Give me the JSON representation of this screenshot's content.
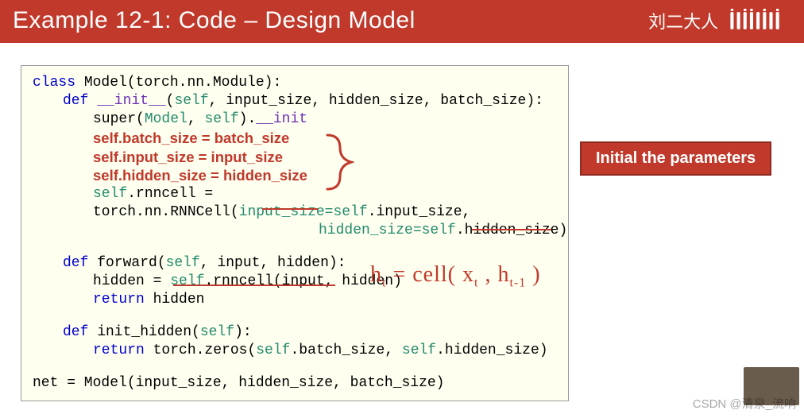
{
  "header": {
    "title": "Example 12-1: Code – Design Model",
    "author": "刘二大人",
    "platform_logo_alt": "bilibili"
  },
  "code": {
    "l1_class": "class",
    "l1_name": " Model(torch.nn.Module):",
    "l2_def": "def",
    "l2_fn": " __init__",
    "l2_sig_open": "(",
    "l2_self": "self",
    "l2_rest": ", input_size, hidden_size, batch_size):",
    "l3_super_open": "super(",
    "l3_super_cls": "Model",
    "l3_super_comma": ", ",
    "l3_super_self": "self",
    "l3_super_close": ").",
    "l3_super_init": "__init",
    "l4": "self.batch_size = batch_size",
    "l5": "self.input_size = input_size",
    "l6": "self.hidden_size = hidden_size",
    "l7_self": "self",
    "l7_mid": ".rnncell = torch.nn.",
    "l7_rnn": "RNNCell",
    "l7_open": "(",
    "l7_arg1k": "input_size=",
    "l7_arg1_self": "self",
    "l7_arg1v": ".input_size,",
    "l8_k": "hidden_size=",
    "l8_self": "self",
    "l8_v": ".hidden_size)",
    "l9_def": "def",
    "l9_fn": " forward(",
    "l9_self": "self",
    "l9_rest": ", input, hidden):",
    "l10_pre": "hidden = ",
    "l10_self": "self",
    "l10_rest": ".rnncell(input, hidden)",
    "l11_ret": "return",
    "l11_val": " hidden",
    "l12_def": "def",
    "l12_fn": " init_hidden(",
    "l12_self": "self",
    "l12_rest": "):",
    "l13_ret": "return",
    "l13_a": " torch.zeros(",
    "l13_self1": "self",
    "l13_b": ".batch_size, ",
    "l13_self2": "self",
    "l13_c": ".hidden_size)",
    "l14": "net = Model(input_size, hidden_size, batch_size)"
  },
  "callout": {
    "label": "Initial the parameters"
  },
  "hand_formula": {
    "lhs_h": "h",
    "lhs_t": "t",
    "eq": " = cell( ",
    "x": "x",
    "xt": "t",
    "comma": " , ",
    "rhs_h": "h",
    "rhs_t": "t-1",
    "close": " )"
  },
  "watermark": "CSDN @清泉_流响"
}
